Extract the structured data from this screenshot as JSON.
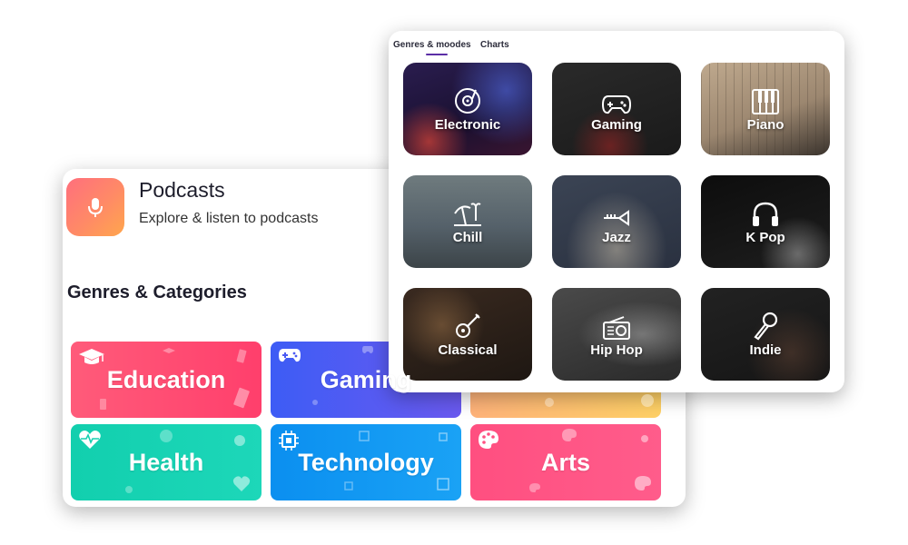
{
  "podcasts": {
    "title": "Podcasts",
    "subtitle": "Explore & listen to podcasts",
    "section_title": "Genres & Categories",
    "icon": "microphone-icon",
    "categories": [
      {
        "label": "Education",
        "icon": "graduation-cap-icon",
        "colors": [
          "#ff5b7a",
          "#ff3f6c"
        ]
      },
      {
        "label": "Gaming",
        "icon": "gamepad-icon",
        "colors": [
          "#3d5cf5",
          "#6a5af0"
        ]
      },
      {
        "label": "",
        "icon": "",
        "colors": [
          "#ffb37a",
          "#ffd166"
        ]
      },
      {
        "label": "Health",
        "icon": "heartbeat-icon",
        "colors": [
          "#12cfae",
          "#1dd7b9"
        ]
      },
      {
        "label": "Technology",
        "icon": "chip-icon",
        "colors": [
          "#0b8ff0",
          "#1aa2f5"
        ]
      },
      {
        "label": "Arts",
        "icon": "palette-icon",
        "colors": [
          "#ff4f80",
          "#ff5c8b"
        ]
      }
    ]
  },
  "genres_panel": {
    "tabs": [
      {
        "label": "Genres & moodes",
        "active": true
      },
      {
        "label": "Charts",
        "active": false
      }
    ],
    "tiles": [
      {
        "label": "Electronic",
        "icon": "turntable-icon"
      },
      {
        "label": "Gaming",
        "icon": "gamepad-icon"
      },
      {
        "label": "Piano",
        "icon": "piano-keys-icon"
      },
      {
        "label": "Chill",
        "icon": "beach-umbrella-icon"
      },
      {
        "label": "Jazz",
        "icon": "trumpet-icon"
      },
      {
        "label": "K Pop",
        "icon": "headphones-icon"
      },
      {
        "label": "Classical",
        "icon": "guitar-icon"
      },
      {
        "label": "Hip Hop",
        "icon": "radio-icon"
      },
      {
        "label": "Indie",
        "icon": "microphone-icon"
      }
    ]
  },
  "colors": {
    "accent": "#5b2ea6",
    "text_dark": "#1d1d2b"
  }
}
